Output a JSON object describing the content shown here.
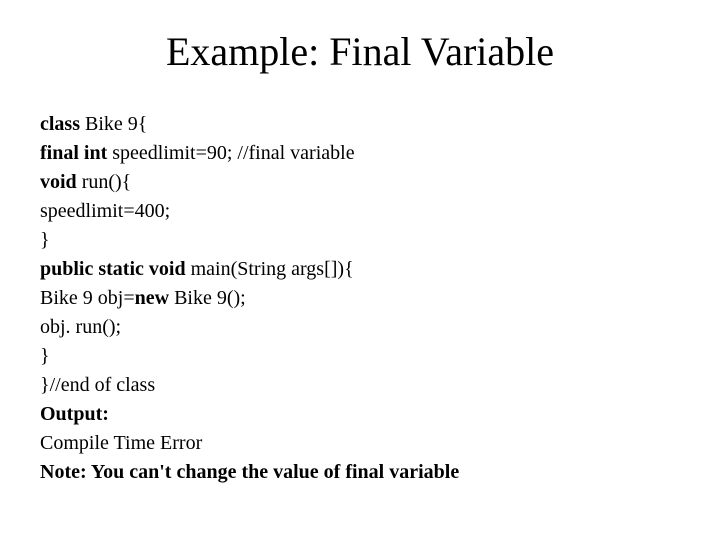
{
  "title": "Example: Final Variable",
  "code": {
    "l1_b": "class",
    "l1_r": " Bike 9{",
    "l2_b": "final int",
    "l2_r": " speedlimit=90; //final variable",
    "l3_b": "void",
    "l3_r": " run(){",
    "l4": " speedlimit=400;",
    "l5": "}",
    "l6_b": "public static void",
    "l6_r": " main(String args[]){",
    "l7a": "Bike 9 obj=",
    "l7_b": "new",
    "l7c": "  Bike 9();",
    "l8": "obj. run();",
    "l9": "}",
    "l10": "}//end of class",
    "output_label": "Output:",
    "output_value": "Compile Time Error",
    "note_b": "Note: You can't change the value of final variable"
  }
}
